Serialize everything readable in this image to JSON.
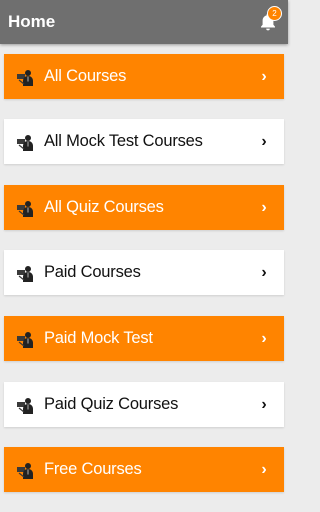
{
  "appbar": {
    "title": "Home",
    "notifications": "2"
  },
  "items": [
    {
      "label": "All Courses",
      "style": "orange"
    },
    {
      "label": "All Mock Test Courses",
      "style": "white"
    },
    {
      "label": "All Quiz Courses",
      "style": "orange"
    },
    {
      "label": "Paid Courses",
      "style": "white"
    },
    {
      "label": "Paid Mock Test",
      "style": "orange"
    },
    {
      "label": "Paid Quiz Courses",
      "style": "white"
    },
    {
      "label": "Free Courses",
      "style": "orange"
    }
  ],
  "colors": {
    "appbar": "#6f6f6f",
    "accent": "#ff8400",
    "background": "#ececec"
  },
  "icons": {
    "item_icon": "teacher-icon",
    "chevron": "chevron-right-icon",
    "bell": "bell-icon"
  }
}
